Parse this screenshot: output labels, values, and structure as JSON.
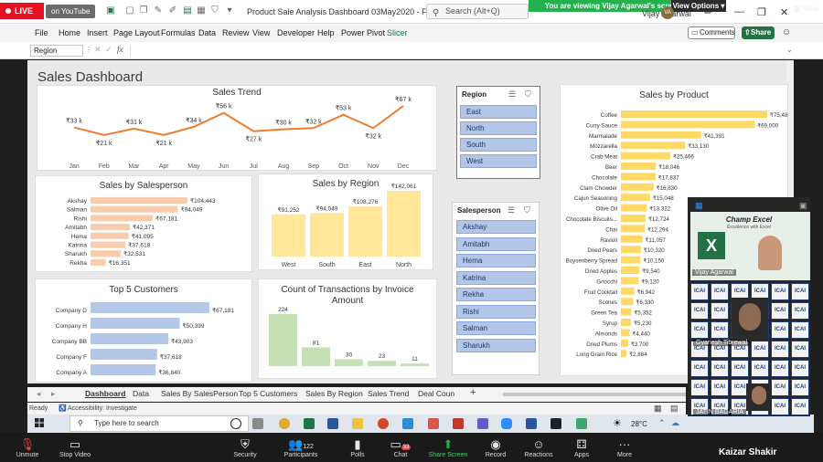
{
  "titlebar": {
    "live_label": "LIVE",
    "youtube_label": "on YouTube",
    "doc_title": "Product Sale Analysis Dashboard 03May2020 - Fi...",
    "search_label": "Search (Alt+Q)",
    "share_banner": "You are viewing Vijay Agarwal's screen",
    "view_options": "View Options",
    "user_name": "Vijay Agarwal",
    "user_initials": "VA",
    "view_button": "View"
  },
  "ribbon": {
    "tabs": [
      "File",
      "Home",
      "Insert",
      "Page Layout",
      "Formulas",
      "Data",
      "Review",
      "View",
      "Developer",
      "Help",
      "Power Pivot",
      "Slicer"
    ],
    "comments_label": "Comments",
    "share_label": "Share"
  },
  "formula_bar": {
    "name_box": "Region",
    "fx": "fx"
  },
  "dashboard": {
    "title": "Sales Dashboard",
    "sales_trend": {
      "title": "Sales Trend",
      "chart_data": {
        "type": "line",
        "title": "Sales Trend",
        "categories": [
          "Jan",
          "Feb",
          "Mar",
          "Apr",
          "May",
          "Jun",
          "Jul",
          "Aug",
          "Sep",
          "Oct",
          "Nov",
          "Dec"
        ],
        "values": [
          33,
          21,
          31,
          21,
          34,
          56,
          27,
          30,
          32,
          53,
          32,
          67
        ],
        "labels": [
          "₹33 k",
          "₹21 k",
          "₹31 k",
          "₹21 k",
          "₹34 k",
          "₹56 k",
          "₹27 k",
          "₹30 k",
          "₹32 k",
          "₹53 k",
          "₹32 k",
          "₹67 k"
        ],
        "color": "#ed7d31"
      }
    },
    "sales_by_salesperson": {
      "title": "Sales by Salesperson",
      "chart_data": {
        "type": "bar",
        "orientation": "horizontal",
        "title": "Sales by Salesperson",
        "categories": [
          "Akshay",
          "Salman",
          "Rishi",
          "Amitabh",
          "Hema",
          "Katrina",
          "Sharukh",
          "Rekha"
        ],
        "values": [
          104443,
          94049,
          67181,
          42371,
          41095,
          37618,
          32531,
          16351
        ],
        "labels": [
          "₹104,443",
          "₹94,049",
          "₹67,181",
          "₹42,371",
          "₹41,095",
          "₹37,618",
          "₹32,531",
          "₹16,351"
        ],
        "color": "#f8cbad"
      }
    },
    "sales_by_region": {
      "title": "Sales by Region",
      "chart_data": {
        "type": "bar",
        "title": "Sales by Region",
        "categories": [
          "West",
          "South",
          "East",
          "North"
        ],
        "values": [
          91252,
          94049,
          108276,
          142061
        ],
        "labels": [
          "₹91,252",
          "₹94,049",
          "₹108,276",
          "₹142,061"
        ],
        "color": "#ffe699"
      }
    },
    "top_customers": {
      "title": "Top 5 Customers",
      "chart_data": {
        "type": "bar",
        "orientation": "horizontal",
        "title": "Top 5 Customers",
        "categories": [
          "Company D",
          "Company H",
          "Company BB",
          "Company F",
          "Company A"
        ],
        "values": [
          67181,
          50399,
          43903,
          37618,
          36840
        ],
        "labels": [
          "₹67,181",
          "₹50,399",
          "₹43,903",
          "₹37,618",
          "₹36,840"
        ],
        "color": "#b4c7e7"
      }
    },
    "transactions": {
      "title_line1": "Count of Transactions by Invoice",
      "title_line2": "Amount",
      "chart_data": {
        "type": "bar",
        "title": "Count of Transactions by Invoice Amount",
        "values": [
          224,
          81,
          30,
          23,
          11
        ],
        "labels": [
          "224",
          "81",
          "30",
          "23",
          "11"
        ],
        "color": "#c5e0b4"
      }
    },
    "sales_by_product": {
      "title": "Sales by Product",
      "chart_data": {
        "type": "bar",
        "orientation": "horizontal",
        "title": "Sales by Product",
        "categories": [
          "Coffee",
          "Curry Sauce",
          "Marmalade",
          "Mozzarella",
          "Crab Meat",
          "Beer",
          "Chocolate",
          "Clam Chowder",
          "Cajun Seasoning",
          "Olive Oil",
          "Chocolate Biscuits...",
          "Chai",
          "Ravioli",
          "Dried Pears",
          "Boysenberry Spread",
          "Dried Apples",
          "Gnocchi",
          "Fruit Cocktail",
          "Scones",
          "Green Tea",
          "Syrup",
          "Almonds",
          "Dried Plums",
          "Long Grain Rice"
        ],
        "values": [
          75480,
          69000,
          41391,
          33130,
          25466,
          18046,
          17837,
          16830,
          15048,
          13322,
          12724,
          12294,
          11057,
          10320,
          10150,
          9540,
          9120,
          6942,
          6330,
          5352,
          5230,
          4440,
          3700,
          2884
        ],
        "labels": [
          "₹75,48",
          "₹69,000",
          "₹41,391",
          "₹33,130",
          "₹25,466",
          "₹18,046",
          "₹17,837",
          "₹16,830",
          "₹15,048",
          "₹13,322",
          "₹12,724",
          "₹12,294",
          "₹11,057",
          "₹10,320",
          "₹10,150",
          "₹9,540",
          "₹9,120",
          "₹6,942",
          "₹6,330",
          "₹5,352",
          "₹5,230",
          "₹4,440",
          "₹3,700",
          "₹2,884"
        ],
        "color": "#ffd966"
      }
    },
    "region_slicer": {
      "header": "Region",
      "items": [
        "East",
        "North",
        "South",
        "West"
      ]
    },
    "salesperson_slicer": {
      "header": "Salesperson",
      "items": [
        "Akshay",
        "Amitabh",
        "Hema",
        "Katrina",
        "Rekha",
        "Rishi",
        "Salman",
        "Sharukh"
      ]
    }
  },
  "sheet_tabs": [
    "Dashboard",
    "Data",
    "Sales By SalesPerson",
    "Top 5 Customers",
    "Sales By Region",
    "Sales Trend",
    "Deal Coun"
  ],
  "status": {
    "ready": "Ready",
    "accessibility": "Accessibility: Investigate"
  },
  "taskbar": {
    "search_placeholder": "Type here to search",
    "weather": "28°C"
  },
  "zoom": {
    "buttons": [
      "Unmute",
      "Stop Video",
      "Security",
      "Participants",
      "Polls",
      "Chat",
      "Share Screen",
      "Record",
      "Reactions",
      "Apps",
      "More"
    ],
    "participants_count": "122",
    "chat_badge": "33",
    "speaker": "Kaizar Shakir"
  },
  "gallery": {
    "brand_line1": "Champ Excel",
    "brand_line2": "Excellence with Excel",
    "names": [
      "Vijay Agarwal",
      "Gyanesh Tibrewal",
      "JATIN BAGARIA"
    ],
    "tile_label": "ICAI"
  }
}
